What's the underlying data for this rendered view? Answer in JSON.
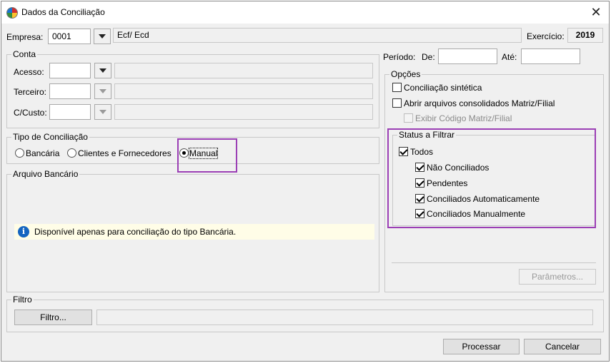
{
  "window": {
    "title": "Dados da Conciliação"
  },
  "header": {
    "empresa_label": "Empresa:",
    "empresa_code": "0001",
    "empresa_name": "Ecf/ Ecd",
    "exercicio_label": "Exercício:",
    "exercicio_value": "2019"
  },
  "conta": {
    "legend": "Conta",
    "acesso_label": "Acesso:",
    "terceiro_label": "Terceiro:",
    "ccusto_label": "C/Custo:"
  },
  "periodo": {
    "label": "Período:",
    "de_label": "De:",
    "de_value": "",
    "ate_label": "Até:",
    "ate_value": ""
  },
  "tipo_conciliacao": {
    "legend": "Tipo de Conciliação",
    "options": [
      "Bancária",
      "Clientes e Fornecedores",
      "Manual"
    ],
    "selected": "Manual"
  },
  "arquivo_bancario": {
    "legend": "Arquivo Bancário",
    "info_text": "Disponível apenas para conciliação do tipo Bancária."
  },
  "opcoes": {
    "legend": "Opções",
    "conciliacao_sintetica": {
      "label": "Conciliação sintética",
      "checked": false
    },
    "abrir_consolidados": {
      "label": "Abrir arquivos consolidados Matriz/Filial",
      "checked": false
    },
    "exibir_codigo": {
      "label": "Exibir Código Matriz/Filial",
      "checked": false,
      "disabled": true
    }
  },
  "status_filtrar": {
    "legend": "Status a Filtrar",
    "todos": {
      "label": "Todos",
      "checked": true
    },
    "items": [
      {
        "label": "Não Conciliados",
        "checked": true
      },
      {
        "label": "Pendentes",
        "checked": true
      },
      {
        "label": "Conciliados Automaticamente",
        "checked": true
      },
      {
        "label": "Conciliados Manualmente",
        "checked": true
      }
    ]
  },
  "parametros_button": "Parâmetros...",
  "filtro": {
    "legend": "Filtro",
    "button_label": "Filtro...",
    "value": ""
  },
  "footer": {
    "processar_label": "Processar",
    "cancelar_label": "Cancelar"
  },
  "colors": {
    "highlight": "#9b3fb5",
    "info_bg": "#fffde7",
    "info_icon": "#1565c0"
  }
}
